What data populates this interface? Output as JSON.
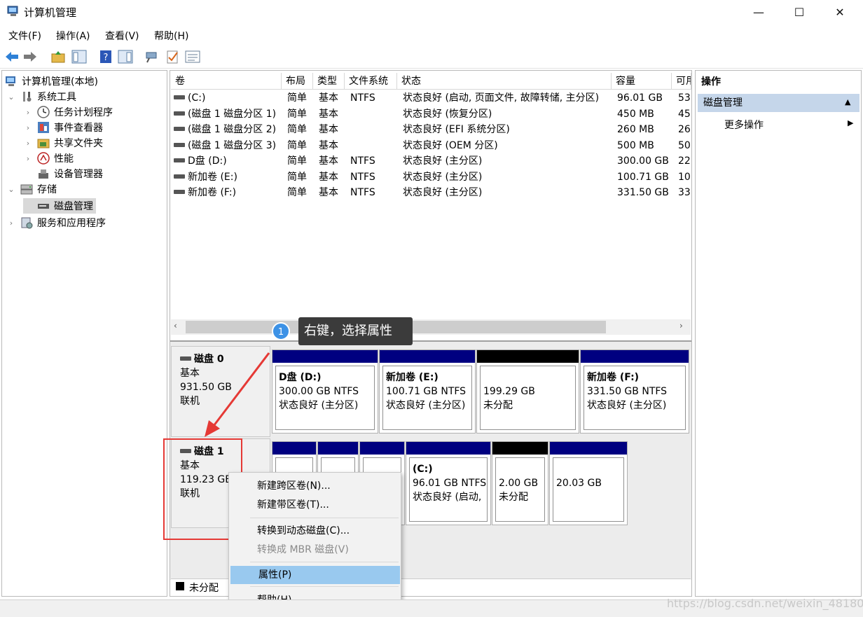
{
  "window": {
    "title": "计算机管理",
    "buttons": {
      "minimize": "—",
      "maximize": "☐",
      "close": "✕"
    }
  },
  "menu": [
    "文件(F)",
    "操作(A)",
    "查看(V)",
    "帮助(H)"
  ],
  "toolbar": [
    "back-arrow-icon",
    "forward-arrow-icon",
    "up-folder-icon",
    "show-hide-tree-icon",
    "help-icon",
    "show-hide-action-pane-icon",
    "connect-icon",
    "check-icon",
    "properties-list-icon"
  ],
  "tree": {
    "root": "计算机管理(本地)",
    "items": [
      {
        "label": "系统工具",
        "level": 1,
        "expanded": true,
        "icon": "tools-icon"
      },
      {
        "label": "任务计划程序",
        "level": 2,
        "icon": "clock-icon"
      },
      {
        "label": "事件查看器",
        "level": 2,
        "icon": "event-viewer-icon"
      },
      {
        "label": "共享文件夹",
        "level": 2,
        "icon": "shared-folder-icon"
      },
      {
        "label": "性能",
        "level": 2,
        "icon": "performance-icon"
      },
      {
        "label": "设备管理器",
        "level": 2,
        "icon": "device-manager-icon"
      },
      {
        "label": "存储",
        "level": 1,
        "expanded": true,
        "icon": "storage-icon"
      },
      {
        "label": "磁盘管理",
        "level": 2,
        "selected": true,
        "icon": "disk-icon"
      },
      {
        "label": "服务和应用程序",
        "level": 1,
        "icon": "services-icon"
      }
    ]
  },
  "volume_list": {
    "columns": [
      "卷",
      "布局",
      "类型",
      "文件系统",
      "状态",
      "容量",
      "可用"
    ],
    "rows": [
      [
        "(C:)",
        "简单",
        "基本",
        "NTFS",
        "状态良好 (启动, 页面文件, 故障转储, 主分区)",
        "96.01 GB",
        "53"
      ],
      [
        "(磁盘 1 磁盘分区 1)",
        "简单",
        "基本",
        "",
        "状态良好 (恢复分区)",
        "450 MB",
        "45"
      ],
      [
        "(磁盘 1 磁盘分区 2)",
        "简单",
        "基本",
        "",
        "状态良好 (EFI 系统分区)",
        "260 MB",
        "26"
      ],
      [
        "(磁盘 1 磁盘分区 3)",
        "简单",
        "基本",
        "",
        "状态良好 (OEM 分区)",
        "500 MB",
        "50"
      ],
      [
        "D盘 (D:)",
        "简单",
        "基本",
        "NTFS",
        "状态良好 (主分区)",
        "300.00 GB",
        "22"
      ],
      [
        "新加卷 (E:)",
        "简单",
        "基本",
        "NTFS",
        "状态良好 (主分区)",
        "100.71 GB",
        "10"
      ],
      [
        "新加卷 (F:)",
        "简单",
        "基本",
        "NTFS",
        "状态良好 (主分区)",
        "331.50 GB",
        "33"
      ]
    ]
  },
  "disks": [
    {
      "name": "磁盘 0",
      "type": "基本",
      "size": "931.50 GB",
      "status": "联机",
      "partitions": [
        {
          "title": "D盘 (D:)",
          "line2": "300.00 GB NTFS",
          "line3": "状态良好 (主分区)",
          "color": "#000080"
        },
        {
          "title": "新加卷 (E:)",
          "line2": "100.71 GB NTFS",
          "line3": "状态良好 (主分区)",
          "color": "#000080"
        },
        {
          "title": "",
          "line2": "199.29 GB",
          "line3": "未分配",
          "color": "#000000"
        },
        {
          "title": "新加卷 (F:)",
          "line2": "331.50 GB NTFS",
          "line3": "状态良好 (主分区)",
          "color": "#000080"
        }
      ]
    },
    {
      "name": "磁盘 1",
      "type": "基本",
      "size": "119.23 GB",
      "status": "联机",
      "partitions": [
        {
          "title": "",
          "line2": "",
          "line3": "",
          "color": "#000080"
        },
        {
          "title": "",
          "line2": "",
          "line3": "",
          "color": "#000080"
        },
        {
          "title": "",
          "line2": "",
          "line3": "",
          "color": "#000080"
        },
        {
          "title": "(C:)",
          "line2": "96.01 GB NTFS",
          "line3": "状态良好 (启动,",
          "color": "#000080"
        },
        {
          "title": "",
          "line2": "2.00 GB",
          "line3": "未分配",
          "color": "#000000"
        },
        {
          "title": "",
          "line2": "20.03 GB",
          "line3": "",
          "color": "#000080"
        }
      ]
    }
  ],
  "legend": {
    "unallocated": "未分配"
  },
  "context_menu": {
    "items": [
      {
        "label": "新建跨区卷(N)...",
        "enabled": true
      },
      {
        "label": "新建带区卷(T)...",
        "enabled": true
      },
      {
        "label": "转换到动态磁盘(C)...",
        "enabled": true
      },
      {
        "label": "转换成 MBR 磁盘(V)",
        "enabled": false
      },
      {
        "label": "属性(P)",
        "enabled": true,
        "highlighted": true
      },
      {
        "label": "帮助(H)",
        "enabled": true
      }
    ]
  },
  "actions": {
    "header": "操作",
    "section": "磁盘管理",
    "more": "更多操作"
  },
  "annotation": {
    "step": "1",
    "text": "右键，选择属性"
  },
  "watermark": "https://blog.csdn.net/weixin_48180029",
  "colors": {
    "primary_partition": "#000080",
    "unallocated": "#000000",
    "menu_highlight": "#99c9ef",
    "annotation_red": "#e53935",
    "badge_blue": "#3d92e6"
  }
}
